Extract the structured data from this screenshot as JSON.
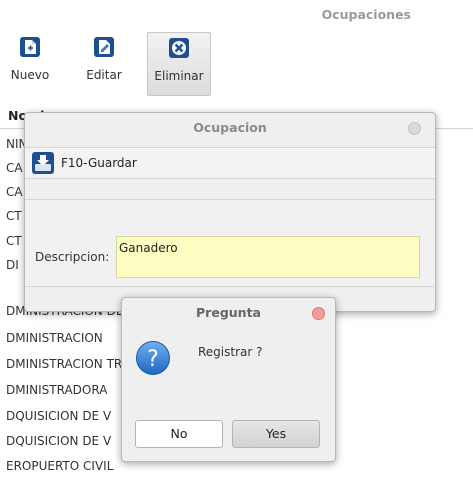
{
  "window": {
    "title": "Ocupaciones"
  },
  "toolbar": {
    "new_label": "Nuevo",
    "edit_label": "Editar",
    "delete_label": "Eliminar",
    "icons": [
      "new-document-icon",
      "edit-document-icon",
      "delete-x-icon"
    ]
  },
  "table": {
    "column_header": "Nombre",
    "rows": [
      "NINGUNA>",
      "CA",
      "CA",
      "CT",
      "CT",
      "DI",
      "DMINISTRACION DE COMERCIO Y SERVICIOS",
      "DMINISTRACION",
      "DMINISTRACION                                  TRES Y FL",
      "DMINISTRADORA",
      "DQUISICION DE V",
      "DQUISICION DE V",
      "EROPUERTO CIVIL"
    ]
  },
  "dialog": {
    "title": "Ocupacion",
    "save_label": "F10-Guardar",
    "field_label": "Descripcion:",
    "field_value": "Ganadero"
  },
  "question": {
    "title": "Pregunta",
    "message": "Registrar ?",
    "no_label": "No",
    "yes_label": "Yes"
  },
  "colors": {
    "input_bg": "#fdfdc2",
    "close_active": "#f19a9a",
    "question_icon": "#2f7fd6"
  }
}
